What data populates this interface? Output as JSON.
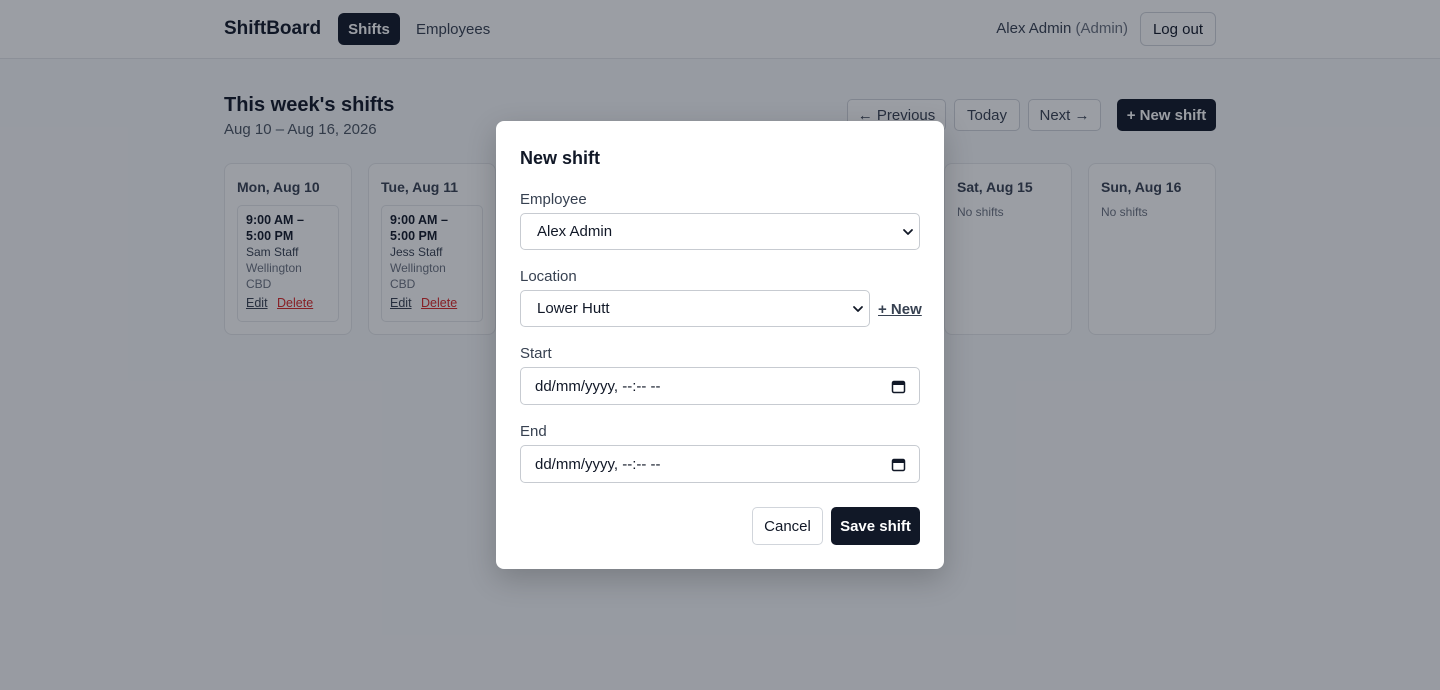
{
  "header": {
    "brand": "ShiftBoard",
    "nav": {
      "shifts": "Shifts",
      "employees": "Employees"
    },
    "user_name": "Alex Admin",
    "user_role": "(Admin)",
    "logout": "Log out"
  },
  "week": {
    "title": "This week's shifts",
    "range": "Aug 10 – Aug 16, 2026",
    "prev": "← Previous",
    "today": "Today",
    "next": "Next →",
    "new_shift": "+ New shift"
  },
  "days": [
    {
      "title": "Mon, Aug 10",
      "shift": {
        "time": "9:00 AM – 5:00 PM",
        "employee": "Sam Staff",
        "location": "Wellington CBD",
        "edit": "Edit",
        "delete": "Delete"
      }
    },
    {
      "title": "Tue, Aug 11",
      "shift": {
        "time": "9:00 AM – 5:00 PM",
        "employee": "Jess Staff",
        "location": "Wellington CBD",
        "edit": "Edit",
        "delete": "Delete"
      }
    },
    {
      "title": "Sat, Aug 15",
      "empty": "No shifts"
    },
    {
      "title": "Sun, Aug 16",
      "empty": "No shifts"
    }
  ],
  "modal": {
    "title": "New shift",
    "employee_label": "Employee",
    "employee_value": "Alex Admin",
    "location_label": "Location",
    "location_value": "Lower Hutt",
    "new_location": "+ New",
    "start_label": "Start",
    "start_placeholder": "dd/mm/yyyy, --:-- --",
    "end_label": "End",
    "end_placeholder": "dd/mm/yyyy, --:-- --",
    "cancel": "Cancel",
    "save": "Save shift"
  },
  "icons": {
    "select": "chevron-down-icon",
    "date": "calendar-icon"
  },
  "colors": {
    "primary": "#111827",
    "danger": "#dc2626",
    "overlay": "#111827"
  }
}
